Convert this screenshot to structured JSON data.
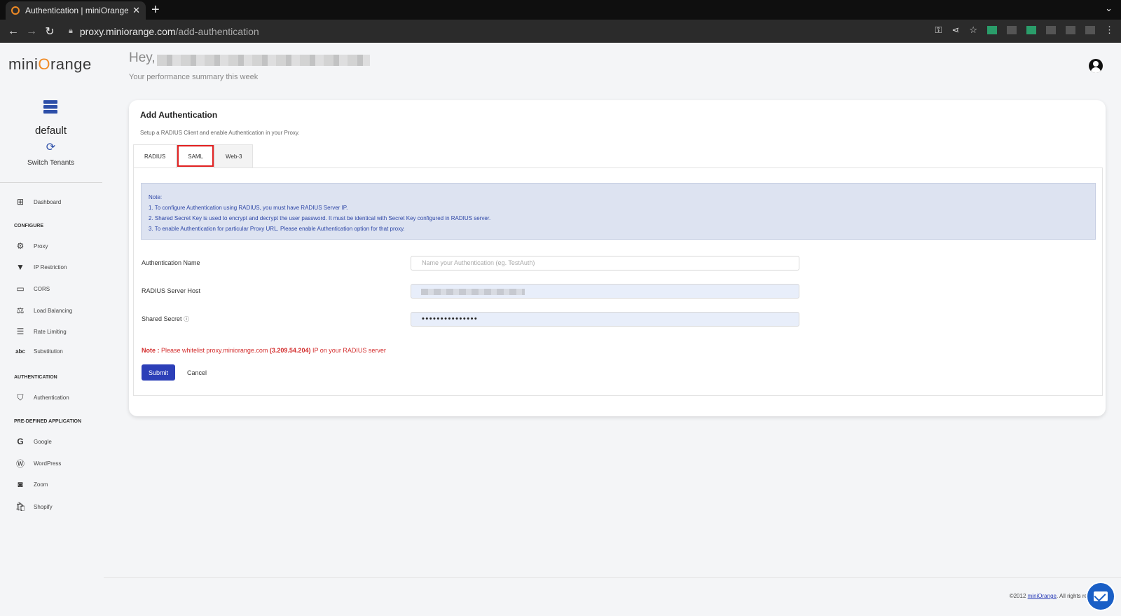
{
  "browser": {
    "tab_title": "Authentication | miniOrange",
    "url_host": "proxy.miniorange.com",
    "url_path": "/add-authentication"
  },
  "sidebar": {
    "logo_pre": "mini",
    "logo_o": "O",
    "logo_post": "range",
    "tenant": "default",
    "switch_label": "Switch Tenants",
    "dashboard": "Dashboard",
    "sections": {
      "configure": "CONFIGURE",
      "authentication": "AUTHENTICATION",
      "predefined": "PRE-DEFINED APPLICATION"
    },
    "items": {
      "proxy": "Proxy",
      "ip_restriction": "IP Restriction",
      "cors": "CORS",
      "load_balancing": "Load Balancing",
      "rate_limiting": "Rate Limiting",
      "substitution": "Substitution",
      "authentication": "Authentication",
      "google": "Google",
      "wordpress": "WordPress",
      "zoom": "Zoom",
      "shopify": "Shopify"
    }
  },
  "header": {
    "greeting": "Hey,",
    "subtitle": "Your performance summary this week"
  },
  "card": {
    "title": "Add Authentication",
    "description": "Setup a RADIUS Client and enable Authentication in your Proxy.",
    "tabs": [
      "RADIUS",
      "SAML",
      "Web-3"
    ],
    "note": {
      "heading": "Note:",
      "lines": [
        "1. To configure Authentication using RADIUS, you must have RADIUS Server IP.",
        "2. Shared Secret Key is used to encrypt and decrypt the user password. It must be identical with Secret Key configured in RADIUS server.",
        "3. To enable Authentication for particular Proxy URL. Please enable Authentication option for that proxy."
      ]
    },
    "fields": {
      "auth_name_label": "Authentication Name",
      "auth_name_placeholder": "Name your Authentication (eg. TestAuth)",
      "host_label": "RADIUS Server Host",
      "secret_label": "Shared Secret",
      "secret_info": "ⓘ",
      "secret_value": "•••••••••••••••"
    },
    "whitelist": {
      "prefix": "Note :",
      "text": " Please whitelist proxy.miniorange.com ",
      "ip": "(3.209.54.204)",
      "suffix": " IP on your RADIUS server"
    },
    "submit": "Submit",
    "cancel": "Cancel"
  },
  "footer": {
    "copyright": "©2012 ",
    "brand": "miniOrange",
    "rights": ". All rights res"
  }
}
